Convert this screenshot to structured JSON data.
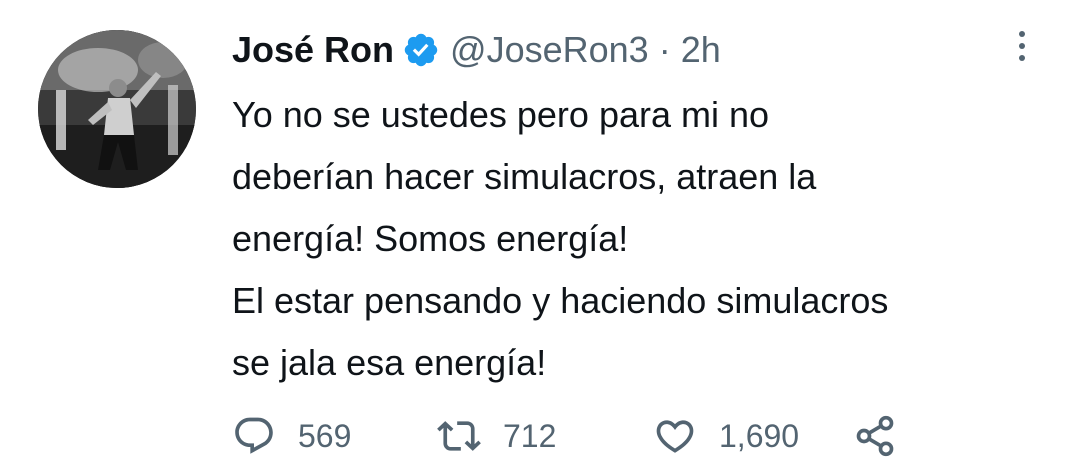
{
  "tweet": {
    "author_name": "José Ron",
    "handle": "@JoseRon3",
    "separator": "·",
    "time": "2h",
    "text_lines": [
      "Yo no se ustedes pero para mi no",
      "deberían hacer simulacros, atraen la",
      "energía! Somos energía!",
      "El estar pensando y haciendo simulacros",
      "se jala esa energía!"
    ],
    "counts": {
      "replies": "569",
      "retweets": "712",
      "likes": "1,690"
    }
  },
  "icons": {
    "avatar": "avatar-photo",
    "verified": "verified-badge-icon",
    "more": "more-options-icon",
    "reply": "reply-icon",
    "retweet": "retweet-icon",
    "like": "like-heart-icon",
    "share": "share-icon"
  },
  "colors": {
    "text_primary": "#0f1419",
    "text_secondary": "#536471",
    "verified_blue": "#1d9bf0",
    "background": "#ffffff"
  }
}
